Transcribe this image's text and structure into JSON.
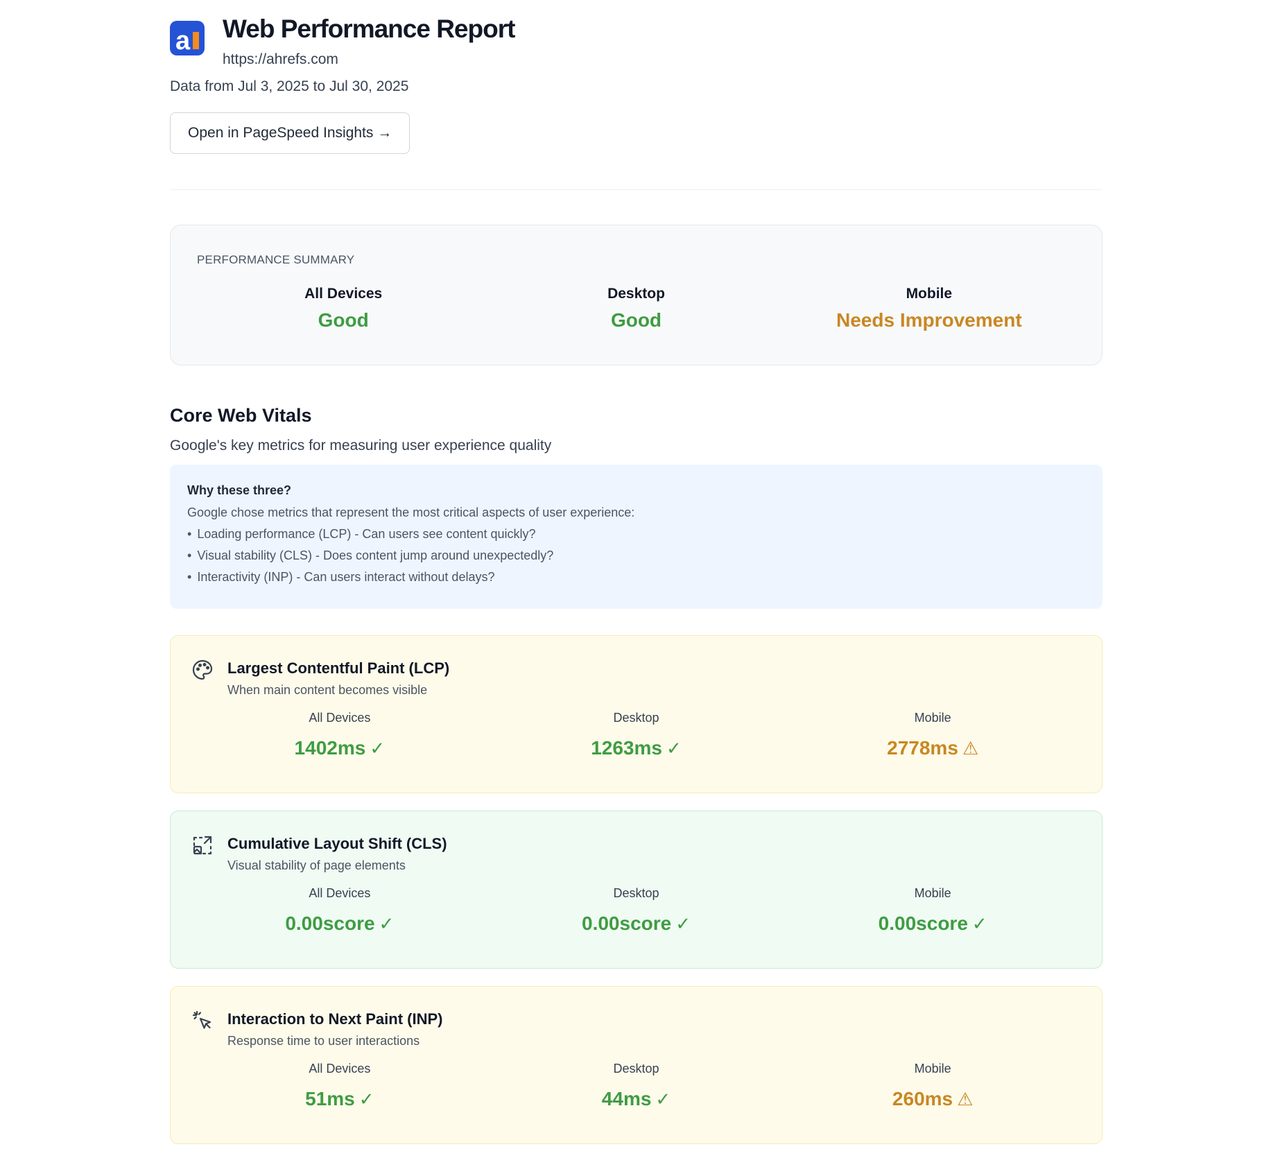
{
  "header": {
    "title": "Web Performance Report",
    "url": "https://ahrefs.com",
    "date_range": "Data from Jul 3, 2025 to Jul 30, 2025",
    "psi_button": "Open in PageSpeed Insights →",
    "logo_text": "a"
  },
  "summary": {
    "label": "PERFORMANCE SUMMARY",
    "columns": [
      {
        "device": "All Devices",
        "status": "Good"
      },
      {
        "device": "Desktop",
        "status": "Good"
      },
      {
        "device": "Mobile",
        "status": "Needs Improvement"
      }
    ]
  },
  "cwv": {
    "title": "Core Web Vitals",
    "subtitle": "Google's key metrics for measuring user experience quality",
    "why_title": "Why these three?",
    "why_desc": "Google chose metrics that represent the most critical aspects of user experience:",
    "why_items": [
      "Loading performance (LCP) - Can users see content quickly?",
      "Visual stability (CLS) - Does content jump around unexpectedly?",
      "Interactivity (INP) - Can users interact without delays?"
    ]
  },
  "metrics": [
    {
      "icon": "palette-icon",
      "title": "Largest Contentful Paint (LCP)",
      "desc": "When main content becomes visible",
      "values": [
        {
          "label": "All Devices",
          "value": "1402ms",
          "mark": "✓"
        },
        {
          "label": "Desktop",
          "value": "1263ms",
          "mark": "✓"
        },
        {
          "label": "Mobile",
          "value": "2778ms",
          "mark": "⚠"
        }
      ]
    },
    {
      "icon": "layout-shift-icon",
      "title": "Cumulative Layout Shift (CLS)",
      "desc": "Visual stability of page elements",
      "values": [
        {
          "label": "All Devices",
          "value": "0.00score",
          "mark": "✓"
        },
        {
          "label": "Desktop",
          "value": "0.00score",
          "mark": "✓"
        },
        {
          "label": "Mobile",
          "value": "0.00score",
          "mark": "✓"
        }
      ]
    },
    {
      "icon": "pointer-click-icon",
      "title": "Interaction to Next Paint (INP)",
      "desc": "Response time to user interactions",
      "values": [
        {
          "label": "All Devices",
          "value": "51ms",
          "mark": "✓"
        },
        {
          "label": "Desktop",
          "value": "44ms",
          "mark": "✓"
        },
        {
          "label": "Mobile",
          "value": "260ms",
          "mark": "⚠"
        }
      ]
    }
  ],
  "colors": {
    "good": "#3f9c43",
    "warn": "#c98722",
    "logo_blue": "#2453d6",
    "logo_orange": "#f58a1f"
  }
}
